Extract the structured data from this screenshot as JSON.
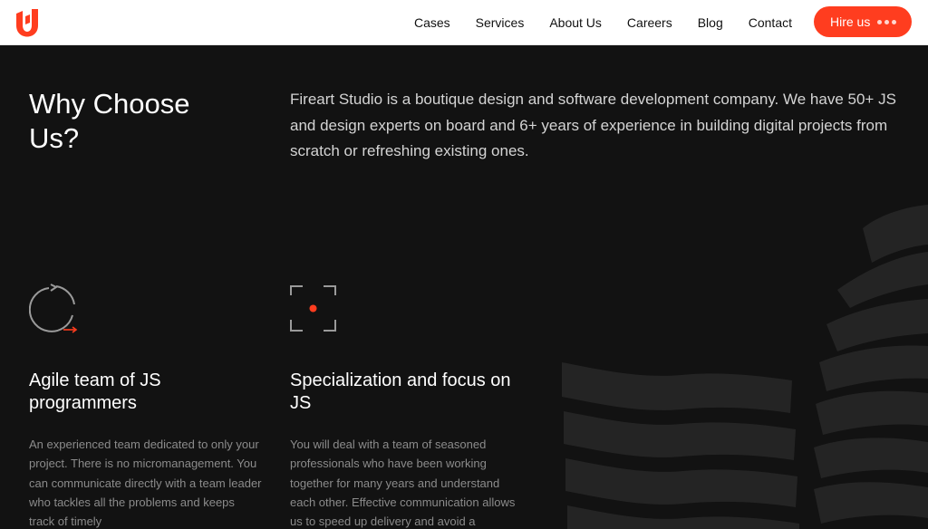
{
  "header": {
    "nav": [
      "Cases",
      "Services",
      "About Us",
      "Careers",
      "Blog",
      "Contact"
    ],
    "hire_label": "Hire us"
  },
  "hero": {
    "title": "Why Choose Us?",
    "description": "Fireart Studio is a boutique design and software development company. We have 50+ JS and design experts on board and 6+ years of experience in building digital projects from scratch or refreshing existing ones."
  },
  "features": [
    {
      "icon": "refresh-cycle-icon",
      "title": "Agile team of JS programmers",
      "text": "An experienced team dedicated to only your project. There is no micromanagement. You can communicate directly with a team leader who tackles all the problems and keeps track of timely"
    },
    {
      "icon": "focus-target-icon",
      "title": "Specialization and focus on JS",
      "text": "You will deal with a team of seasoned professionals who have been working together for many years and understand each other. Effective communication allows us to speed up delivery and avoid a"
    }
  ],
  "colors": {
    "accent": "#ff3d1f",
    "background": "#121212",
    "header_bg": "#ffffff"
  }
}
